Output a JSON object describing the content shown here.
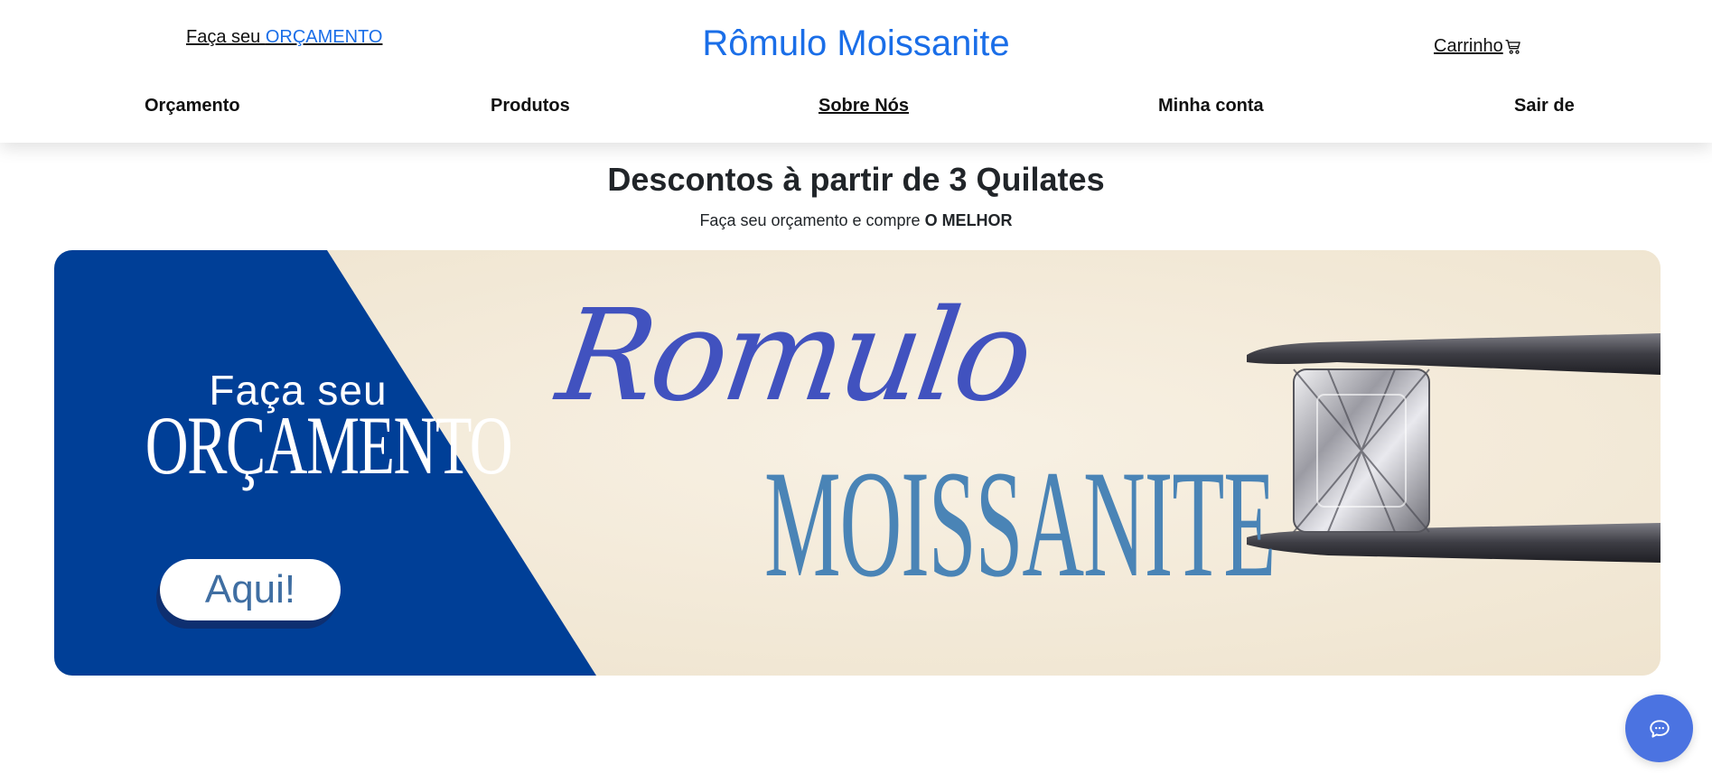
{
  "header": {
    "quote_prefix": "Faça seu ",
    "quote_accent": "ORÇAMENTO",
    "brand": "Rômulo Moissanite",
    "cart_label": "Carrinho",
    "cart_icon": "cart-icon"
  },
  "nav": {
    "items": [
      {
        "label": "Orçamento"
      },
      {
        "label": "Produtos"
      },
      {
        "label": "Sobre Nós",
        "active": true
      },
      {
        "label": "Minha conta"
      },
      {
        "label": "Sair de"
      }
    ]
  },
  "hero": {
    "headline": "Descontos à partir de 3 Quilates",
    "sub_prefix": "Faça seu orçamento e compre ",
    "sub_bold": "O MELHOR"
  },
  "banner": {
    "faca_seu": "Faça seu",
    "orcamento": "ORÇAMENTO",
    "button_label": "Aqui!",
    "title_script": "Romulo",
    "title_caps": "MOISSANITE",
    "image": "moissanite-gem-in-tweezers",
    "colors": {
      "panel_blue": "#003f97",
      "background": "#f4ecdc",
      "script": "#4152bf",
      "caps": "#4a84b6"
    }
  },
  "chat": {
    "icon": "chat-bubble-icon",
    "color": "#4b73e1"
  },
  "colors": {
    "brand": "#1a6ee8"
  }
}
